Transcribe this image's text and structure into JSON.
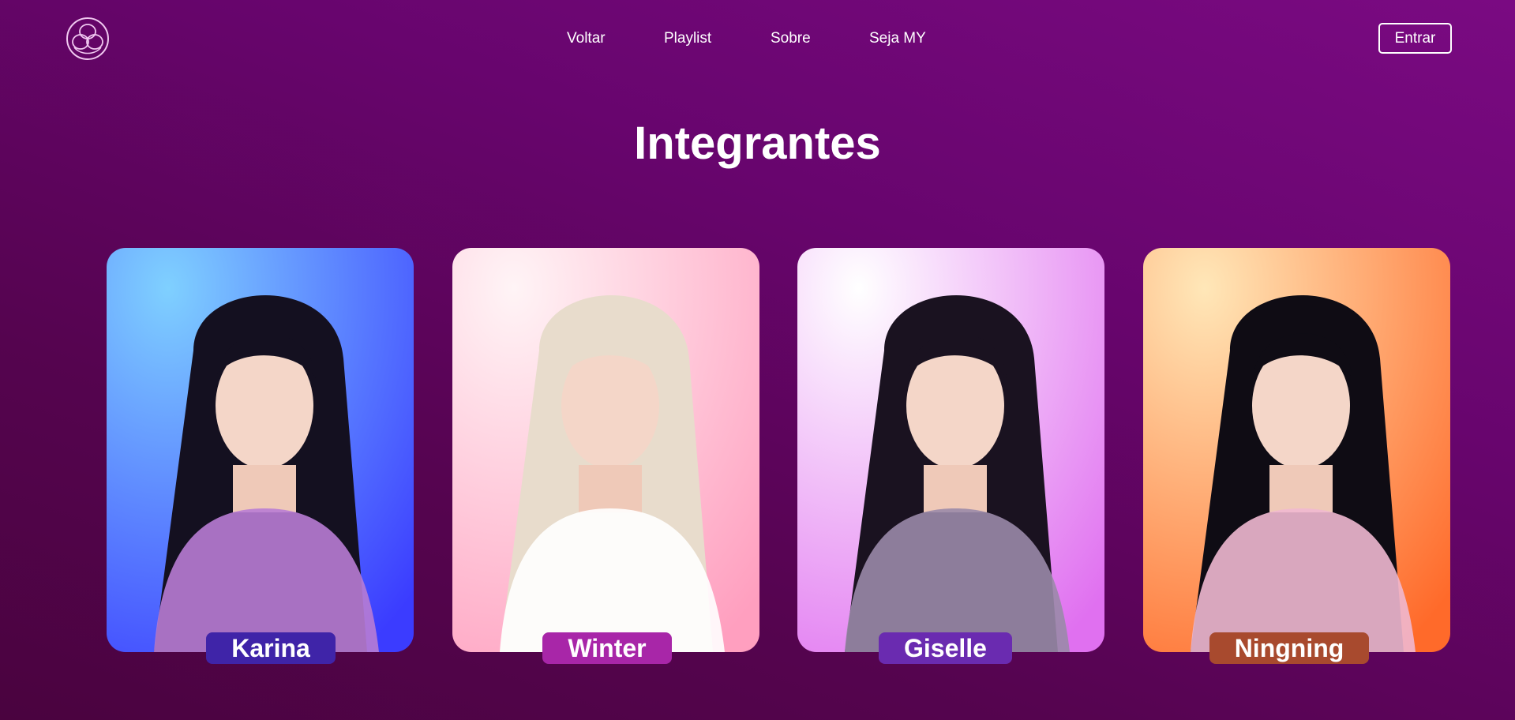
{
  "header": {
    "logo_icon": "aespa-logo-icon",
    "nav": [
      {
        "label": "Voltar"
      },
      {
        "label": "Playlist"
      },
      {
        "label": "Sobre"
      },
      {
        "label": "Seja MY"
      }
    ],
    "login_label": "Entrar"
  },
  "main": {
    "title": "Integrantes",
    "members": [
      {
        "name": "Karina",
        "badge_color": "#3f24a8",
        "bg_from": "#7fd0ff",
        "bg_to": "#3b3cff",
        "hair": "#141020",
        "accent": "#b87cd4"
      },
      {
        "name": "Winter",
        "badge_color": "#a826a8",
        "bg_from": "#fff4f6",
        "bg_to": "#ff9fbf",
        "hair": "#e8dccc",
        "accent": "#ffffff"
      },
      {
        "name": "Giselle",
        "badge_color": "#6a2bb0",
        "bg_from": "#ffffff",
        "bg_to": "#e070f0",
        "hair": "#1a1220",
        "accent": "#9a8aa8"
      },
      {
        "name": "Ningning",
        "badge_color": "#a84a2e",
        "bg_from": "#ffe7b8",
        "bg_to": "#ff6a2a",
        "hair": "#0f0c14",
        "accent": "#f0b8d0"
      }
    ]
  }
}
